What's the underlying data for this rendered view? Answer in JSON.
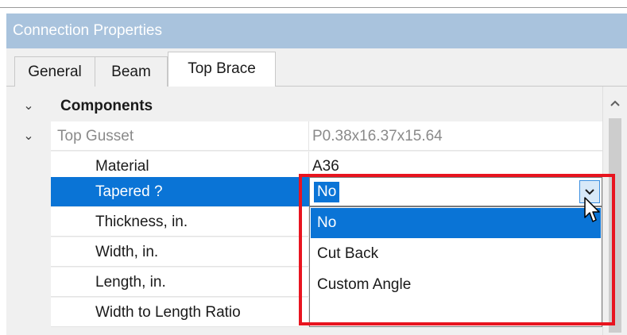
{
  "panel": {
    "title": "Connection Properties"
  },
  "tabs": [
    {
      "label": "General",
      "active": false
    },
    {
      "label": "Beam",
      "active": false
    },
    {
      "label": "Top Brace",
      "active": true
    }
  ],
  "grid": {
    "category": {
      "label": "Components",
      "expander": "⌄"
    },
    "group": {
      "label": "Top Gusset",
      "value": "P0.38x16.37x15.64",
      "expander": "⌄"
    },
    "rows": [
      {
        "label": "Material",
        "value": "A36"
      },
      {
        "label": "Tapered ?",
        "value": "No",
        "selected": true
      },
      {
        "label": "Thickness, in.",
        "value": ""
      },
      {
        "label": "Width, in.",
        "value": ""
      },
      {
        "label": "Length, in.",
        "value": ""
      },
      {
        "label": "Width to Length Ratio",
        "value": ""
      }
    ]
  },
  "tapered_dropdown": {
    "current_value": "No",
    "options": [
      "No",
      "Cut Back",
      "Custom Angle"
    ],
    "highlighted": "No",
    "arrow_icon": "chevron-down-icon"
  },
  "scrollbar": {
    "up_icon": "chevron-up-icon"
  },
  "colors": {
    "title_bar": "#a9c3dd",
    "selection": "#0a74d6",
    "highlight_frame": "#e8141f"
  }
}
